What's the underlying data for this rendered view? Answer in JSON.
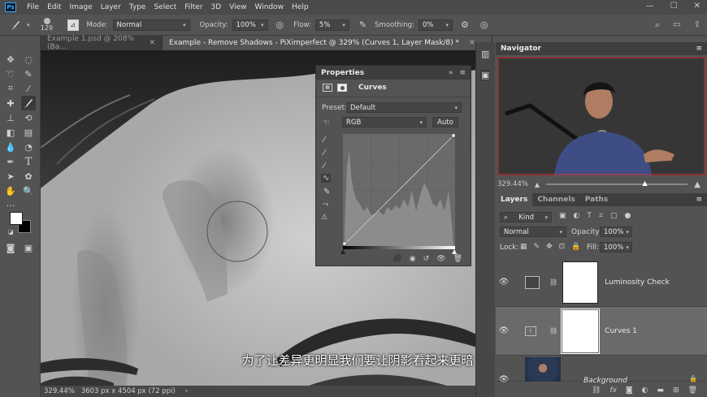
{
  "app": {
    "logo": "Ps"
  },
  "menu": [
    "File",
    "Edit",
    "Image",
    "Layer",
    "Type",
    "Select",
    "Filter",
    "3D",
    "View",
    "Window",
    "Help"
  ],
  "options": {
    "brush_size": "129",
    "mode_label": "Mode:",
    "mode_value": "Normal",
    "opacity_label": "Opacity:",
    "opacity_value": "100%",
    "flow_label": "Flow:",
    "flow_value": "5%",
    "smoothing_label": "Smoothing:",
    "smoothing_value": "0%"
  },
  "tabs": [
    {
      "label": "Example 1.psd @ 208% (Ba..."
    },
    {
      "label": "Example - Remove Shadows - PiXimperfect @ 329% (Curves 1, Layer Mask/8) *"
    }
  ],
  "status": {
    "zoom": "329.44%",
    "doc_info": "3603 px x 4504 px (72 ppi)"
  },
  "subtitle": "为了让差异更明显我们要让阴影看起来更暗",
  "properties": {
    "title": "Properties",
    "subtitle": "Curves",
    "preset_label": "Preset:",
    "preset_value": "Default",
    "channel_value": "RGB",
    "auto_label": "Auto"
  },
  "navigator": {
    "title": "Navigator",
    "zoom": "329.44%"
  },
  "layers_panel": {
    "tabs": [
      "Layers",
      "Channels",
      "Paths"
    ],
    "filter_label": "Kind",
    "blend_mode": "Normal",
    "opacity_label": "Opacity:",
    "opacity_value": "100%",
    "lock_label": "Lock:",
    "fill_label": "Fill:",
    "fill_value": "100%",
    "layers": [
      {
        "name": "Luminosity Check"
      },
      {
        "name": "Curves 1"
      },
      {
        "name": "Background"
      }
    ]
  },
  "colors": {
    "accent": "#31a8ff",
    "panel_bg": "#535353",
    "dark_bg": "#3e3e3e"
  }
}
